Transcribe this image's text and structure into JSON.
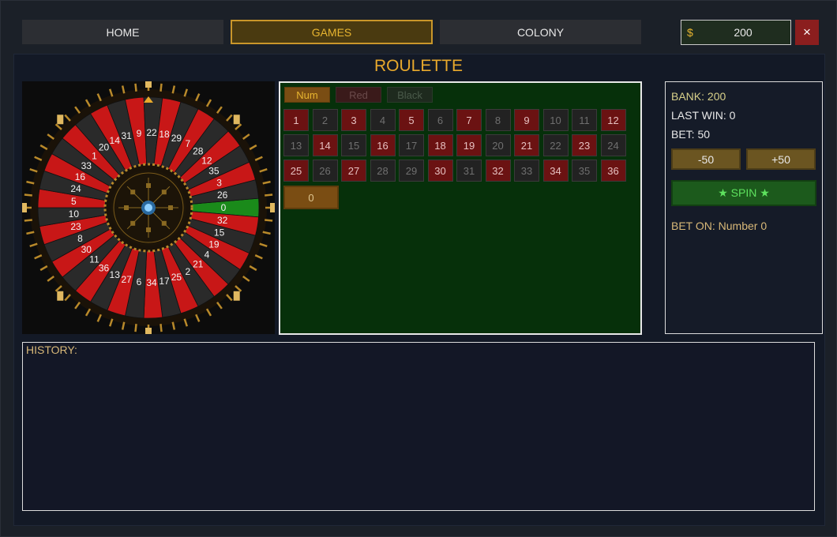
{
  "nav": {
    "home": "HOME",
    "games": "GAMES",
    "colony": "COLONY"
  },
  "money": {
    "currency": "$",
    "value": "200"
  },
  "close_icon": "×",
  "title": "ROULETTE",
  "wheel": {
    "numbers": [
      "0",
      "32",
      "15",
      "19",
      "4",
      "21",
      "2",
      "25",
      "17",
      "34",
      "6",
      "27",
      "13",
      "36",
      "11",
      "30",
      "8",
      "23",
      "10",
      "5",
      "24",
      "16",
      "33",
      "1",
      "20",
      "14",
      "31",
      "9",
      "22",
      "18",
      "29",
      "7",
      "28",
      "12",
      "35",
      "3",
      "26"
    ],
    "highlight": "0"
  },
  "bet_tabs": [
    "Num",
    "Red",
    "Black"
  ],
  "board": {
    "rows": [
      [
        "1",
        "2",
        "3",
        "4",
        "5",
        "6",
        "7",
        "8",
        "9",
        "10",
        "11",
        "12"
      ],
      [
        "13",
        "14",
        "15",
        "16",
        "17",
        "18",
        "19",
        "20",
        "21",
        "22",
        "23",
        "24"
      ],
      [
        "25",
        "26",
        "27",
        "28",
        "29",
        "30",
        "31",
        "32",
        "33",
        "34",
        "35",
        "36"
      ]
    ],
    "red_numbers": [
      "1",
      "3",
      "5",
      "7",
      "9",
      "12",
      "14",
      "16",
      "18",
      "19",
      "21",
      "23",
      "25",
      "27",
      "30",
      "32",
      "34",
      "36"
    ],
    "zero": "0"
  },
  "info": {
    "bank": "BANK: 200",
    "last_win": "LAST WIN: 0",
    "bet": "BET: 50",
    "minus": "-50",
    "plus": "+50",
    "spin": "★ SPIN ★",
    "bet_on": "BET ON: Number 0"
  },
  "history": {
    "label": "HISTORY:"
  },
  "colors": {
    "gold": "#e8a92c",
    "red": "#c81717",
    "dark": "#2a2a2a",
    "green": "#1a8a1a"
  }
}
